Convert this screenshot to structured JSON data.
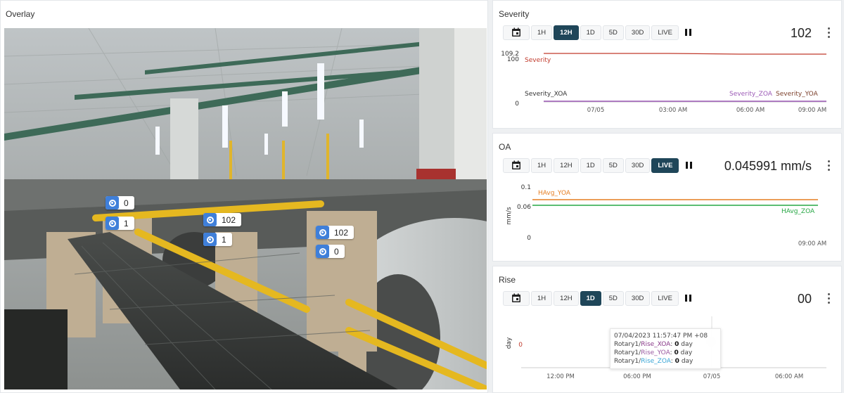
{
  "overlay": {
    "title": "Overlay",
    "badges": [
      {
        "value": "0"
      },
      {
        "value": "1"
      },
      {
        "value": "102"
      },
      {
        "value": "1"
      },
      {
        "value": "102"
      },
      {
        "value": "0"
      }
    ]
  },
  "time_buttons": [
    "1H",
    "12H",
    "1D",
    "5D",
    "30D",
    "LIVE"
  ],
  "severity": {
    "title": "Severity",
    "active_range": "12H",
    "current_value": "102",
    "chart_data": {
      "type": "line",
      "y_ticks": [
        "109.2",
        "100",
        "0"
      ],
      "x_ticks": [
        "07/05",
        "03:00 AM",
        "06:00 AM",
        "09:00 AM"
      ],
      "series": [
        {
          "name": "Severity",
          "color": "#c0392b",
          "values": [
            100.5,
            100.5,
            100.0,
            100.3,
            99.8
          ]
        },
        {
          "name": "Severity_XOA",
          "color": "#333333",
          "values": [
            0,
            0,
            0,
            0,
            0
          ]
        },
        {
          "name": "Severity_ZOA",
          "color": "#9b59b6",
          "values": [
            0,
            0,
            0,
            0,
            0
          ]
        },
        {
          "name": "Severity_YOA",
          "color": "#7b3f2a",
          "values": [
            0,
            0,
            0,
            0,
            0
          ]
        }
      ],
      "ylim": [
        0,
        109.2
      ]
    }
  },
  "oa": {
    "title": "OA",
    "active_range": "LIVE",
    "current_value": "0.045991 mm/s",
    "chart_data": {
      "type": "line",
      "ylabel": "mm/s",
      "y_ticks": [
        "0.1",
        "0.06",
        "0"
      ],
      "x_ticks": [
        "09:00 AM"
      ],
      "series": [
        {
          "name": "HAvg_YOA",
          "color": "#e67e22",
          "values": [
            0.072,
            0.072
          ]
        },
        {
          "name": "HAvg_ZOA",
          "color": "#27a745",
          "values": [
            0.062,
            0.062
          ]
        }
      ],
      "ylim": [
        0,
        0.1
      ]
    }
  },
  "rise": {
    "title": "Rise",
    "active_range": "1D",
    "current_value": "00",
    "chart_data": {
      "type": "line",
      "ylabel": "day",
      "y_ticks": [
        "0"
      ],
      "x_ticks": [
        "12:00 PM",
        "06:00 PM",
        "07/05",
        "06:00 AM"
      ]
    },
    "tooltip": {
      "timestamp": "07/04/2023 11:57:47 PM +08",
      "rows": [
        {
          "prefix": "Rotary1/",
          "name": "Rise_XOA",
          "value": "0",
          "unit": "day"
        },
        {
          "prefix": "Rotary1/",
          "name": "Rise_YOA",
          "value": "0",
          "unit": "day"
        },
        {
          "prefix": "Rotary1/",
          "name": "Rise_ZOA",
          "value": "0",
          "unit": "day"
        }
      ]
    }
  },
  "icons": {
    "calendar": "calendar-icon",
    "pause": "pause-icon",
    "menu": "more-vertical-icon",
    "sensor": "sensor-target-icon"
  }
}
